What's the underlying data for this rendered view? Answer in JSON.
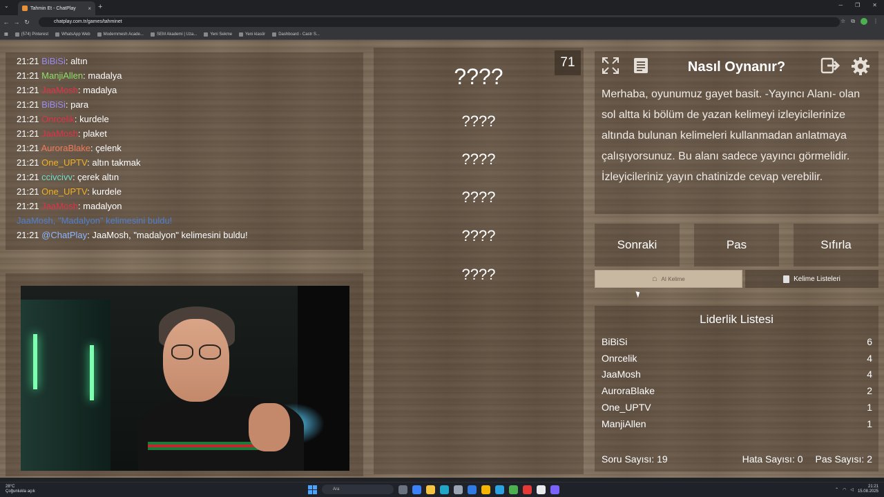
{
  "browser": {
    "tab_title": "Tahmin Et - ChatPlay",
    "tab_close": "×",
    "new_tab": "+",
    "url": "chatplay.com.tr/games/tahminet",
    "bookmarks": [
      "(574) Pinterest",
      "WhatsApp Web",
      "Modernmesh Acade...",
      "SEM Akademi | Uza...",
      "Yeni Sekme",
      "Yeni klasör",
      "Dashboard - Castr S..."
    ]
  },
  "chat": {
    "messages": [
      {
        "time": "21:21",
        "user": "BiBiSi",
        "user_color": "#9c8cf0",
        "text": ": altın"
      },
      {
        "time": "21:21",
        "user": "ManjiAllen",
        "user_color": "#8ee06a",
        "text": ": madalya"
      },
      {
        "time": "21:21",
        "user": "JaaMosh",
        "user_color": "#e0324a",
        "text": ": madalya"
      },
      {
        "time": "21:21",
        "user": "BiBiSi",
        "user_color": "#9c8cf0",
        "text": ": para"
      },
      {
        "time": "21:21",
        "user": "Onrcelik",
        "user_color": "#e0324a",
        "text": ": kurdele"
      },
      {
        "time": "21:21",
        "user": "JaaMosh",
        "user_color": "#e0324a",
        "text": ": plaket"
      },
      {
        "time": "21:21",
        "user": "AuroraBlake",
        "user_color": "#f07a5a",
        "text": ": çelenk"
      },
      {
        "time": "21:21",
        "user": "One_UPTV",
        "user_color": "#f0b020",
        "text": ": altın takmak"
      },
      {
        "time": "21:21",
        "user": "ccivcivv",
        "user_color": "#6fe0c8",
        "text": ": çerek altın"
      },
      {
        "time": "21:21",
        "user": "One_UPTV",
        "user_color": "#f0b020",
        "text": ": kurdele"
      },
      {
        "time": "21:21",
        "user": "JaaMosh",
        "user_color": "#e0324a",
        "text": ": madalyon"
      }
    ],
    "system_line": "JaaMosh, \"Madalyon\" kelimesini buldu!",
    "last": {
      "time": "21:21",
      "user": "@ChatPlay",
      "user_color": "#8fb8ff",
      "text": ": JaaMosh, \"madalyon\" kelimesini buldu!"
    }
  },
  "words": {
    "counter": "71",
    "main": "????",
    "forbidden": [
      "????",
      "????",
      "????",
      "????",
      "????"
    ]
  },
  "howto": {
    "title": "Nasıl Oynanır?",
    "description": "Merhaba, oyunumuz gayet basit. -Yayıncı Alanı- olan sol altta ki bölüm de yazan kelimeyi izleyicilerinize altında bulunan kelimeleri kullanmadan anlatmaya çalışıyorsunuz. Bu alanı sadece yayıncı görmelidir. İzleyicileriniz yayın chatinizde cevap verebilir.",
    "icons": [
      "fullscreen-icon",
      "notes-icon",
      "exit-icon",
      "settings-icon"
    ]
  },
  "controls": {
    "next": "Sonraki",
    "pass": "Pas",
    "reset": "Sıfırla",
    "ai_word": "AI Kelime",
    "word_lists": "Kelime Listeleri"
  },
  "leaderboard": {
    "title": "Liderlik Listesi",
    "rows": [
      {
        "name": "BiBiSi",
        "score": "6"
      },
      {
        "name": "Onrcelik",
        "score": "4"
      },
      {
        "name": "JaaMosh",
        "score": "4"
      },
      {
        "name": "AuroraBlake",
        "score": "2"
      },
      {
        "name": "One_UPTV",
        "score": "1"
      },
      {
        "name": "ManjiAllen",
        "score": "1"
      }
    ],
    "question_count": "Soru Sayısı: 19",
    "error_count": "Hata Sayısı: 0",
    "pass_count": "Pas Sayısı: 2"
  },
  "taskbar": {
    "weather_temp": "28°C",
    "weather_text": "Çoğunlukla açık",
    "search_placeholder": "Ara",
    "time": "21:21",
    "date": "15.08.2025"
  }
}
